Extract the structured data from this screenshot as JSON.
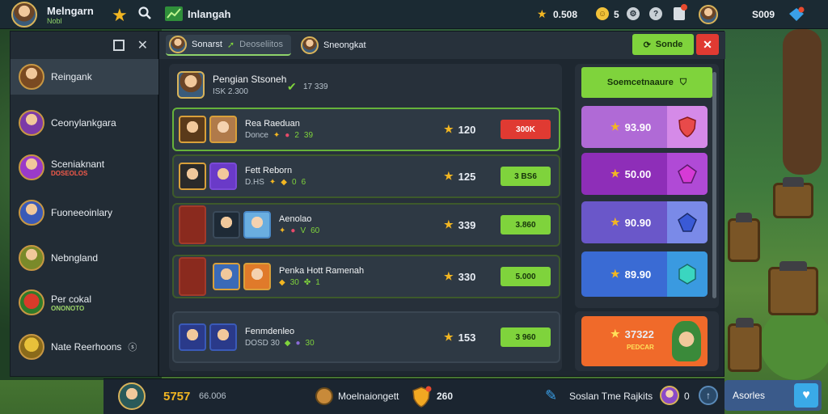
{
  "colors": {
    "accent": "#7fd33c",
    "danger": "#e03a32",
    "gold": "#f2b622",
    "panel": "#27303a"
  },
  "top": {
    "player_name": "Melngarn",
    "player_tag": "Nobl",
    "channel_label": "Inlangah",
    "stars": "0.508",
    "coins": "5",
    "currency_right": "S009"
  },
  "sidebar": {
    "items": [
      {
        "label": "Reingank",
        "sub": ""
      },
      {
        "label": "Ceonylankgara",
        "sub": ""
      },
      {
        "label": "Sceniaknant",
        "sub": "DOSEOLOS"
      },
      {
        "label": "Fuoneeoinlary",
        "sub": ""
      },
      {
        "label": "Nebngland",
        "sub": ""
      },
      {
        "label": "Per cokal",
        "sub": "ONONOTO"
      },
      {
        "label": "Nate Reerhoons",
        "sub": ""
      }
    ]
  },
  "tabs": [
    {
      "label": "Sonarst",
      "extra": "Deoseliitos"
    },
    {
      "label": "Sneongkat"
    }
  ],
  "actions": {
    "green_btn": "Sonde"
  },
  "header": {
    "name": "Pengian Stsoneh",
    "sub": "ISK 2.300",
    "value": "17 339"
  },
  "rows": [
    {
      "name": "Rea Raeduan",
      "meta": "Donce",
      "stats": [
        "2",
        "39"
      ],
      "score": "120",
      "button": "300K",
      "button_style": "red"
    },
    {
      "name": "Fett Reborn",
      "meta": "D.HS",
      "stats": [
        "0",
        "6"
      ],
      "score": "125",
      "button": "3 BS6",
      "button_style": "green"
    },
    {
      "name": "Aenolao",
      "meta": "",
      "stats": [
        "V",
        "60"
      ],
      "score": "339",
      "button": "3.860",
      "button_style": "green"
    },
    {
      "name": "Penka Hott Ramenah",
      "meta": "",
      "stats": [
        "30",
        "1"
      ],
      "score": "330",
      "button": "5.000",
      "button_style": "green"
    },
    {
      "name": "Fenmdenleo",
      "meta": "DOSD 30",
      "stats": [
        "30"
      ],
      "score": "153",
      "button": "3 960",
      "button_style": "green"
    }
  ],
  "shop": {
    "top_label": "Soemcetnaaure",
    "cards": [
      {
        "value": "93.90",
        "color": "#b06ad6",
        "gem_color": "#e84a4a",
        "gem_icon": "red-shield-icon"
      },
      {
        "value": "50.00",
        "color": "#8e2eb8",
        "gem_color": "#c02ec7",
        "gem_icon": "purple-gem-icon"
      },
      {
        "value": "90.90",
        "color": "#6a57c9",
        "gem_color": "#4a63d6",
        "gem_icon": "blue-gem-icon"
      },
      {
        "value": "89.90",
        "color": "#3a6bd4",
        "gem_color": "#3ab0d6",
        "gem_icon": "cyan-gem-icon"
      }
    ],
    "offer": {
      "value": "37322",
      "sub": "PEDCAR"
    }
  },
  "bottom": {
    "score": "5757",
    "score_sub": "66.006",
    "center_label": "Moelnaiongett",
    "center_value": "260",
    "social_label": "Soslan Tme Rajkits",
    "social_count": "0",
    "right_button": "Asorles"
  }
}
